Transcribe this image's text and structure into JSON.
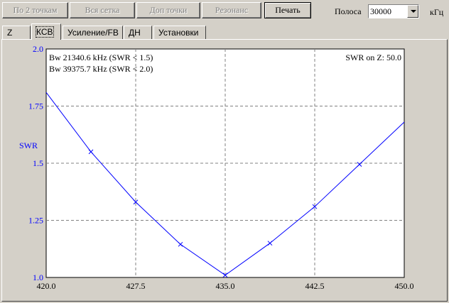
{
  "toolbar": {
    "buttons": [
      {
        "label": "По 2 точкам",
        "enabled": false
      },
      {
        "label": "Вся сетка",
        "enabled": false
      },
      {
        "label": "Доп точки",
        "enabled": false
      },
      {
        "label": "Резонанс",
        "enabled": false
      },
      {
        "label": "Печать",
        "enabled": true
      }
    ],
    "band_label": "Полоса",
    "band_value": "30000",
    "unit_label": "кГц"
  },
  "tabs": [
    {
      "label": "Z",
      "active": false
    },
    {
      "label": "КСВ",
      "active": true
    },
    {
      "label": "Усиление/FB",
      "active": false
    },
    {
      "label": "ДН",
      "active": false
    },
    {
      "label": "Установки",
      "active": false
    }
  ],
  "chart_data": {
    "type": "line",
    "title": "",
    "xlabel": "",
    "ylabel": "SWR",
    "xlim": [
      420.0,
      450.0
    ],
    "ylim": [
      1.0,
      2.0
    ],
    "x_ticks": [
      "420.0",
      "427.5",
      "435.0",
      "442.5",
      "450.0"
    ],
    "y_ticks": [
      "1.0",
      "1.25",
      "1.5",
      "1.75",
      "2.0"
    ],
    "grid": true,
    "series": [
      {
        "color": "#0000ff",
        "x": [
          420.0,
          423.75,
          427.5,
          431.25,
          435.0,
          438.75,
          442.5,
          446.25,
          450.0
        ],
        "y": [
          1.81,
          1.55,
          1.33,
          1.145,
          1.01,
          1.15,
          1.31,
          1.495,
          1.68
        ]
      }
    ],
    "annotations": {
      "bw1": "Bw 21340.6 kHz (SWR < 1.5)",
      "bw2": "Bw 39375.7 kHz (SWR < 2.0)",
      "swr_z": "SWR on Z: 50.0"
    }
  }
}
